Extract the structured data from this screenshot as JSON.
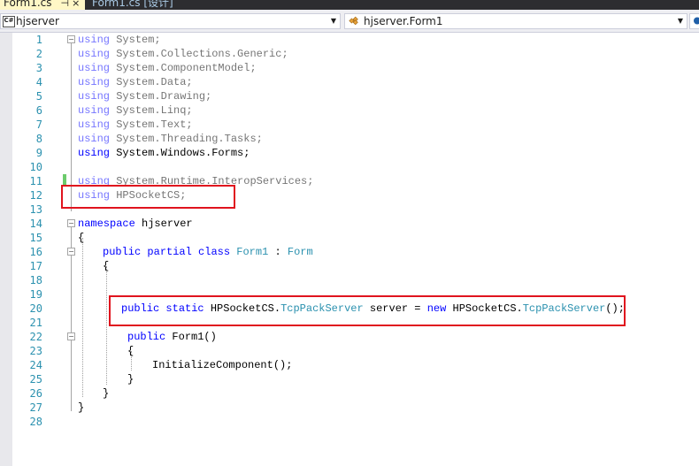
{
  "tabs": [
    {
      "label": "Form1.cs",
      "pin_glyph": "⊣",
      "close_glyph": "×",
      "active": true
    },
    {
      "label": "Form1.cs [设计]",
      "active": false
    }
  ],
  "navbar": {
    "project_badge": "C#",
    "project": "hjserver",
    "class_name": "hjserver.Form1",
    "dropdown_glyph": "▼"
  },
  "code_lines": [
    {
      "n": "1",
      "parts": [
        {
          "t": "using",
          "c": "kw"
        },
        {
          "t": " System;",
          "c": "pl"
        }
      ],
      "dim": true
    },
    {
      "n": "2",
      "parts": [
        {
          "t": "using",
          "c": "kw"
        },
        {
          "t": " System.Collections.Generic;",
          "c": "pl"
        }
      ],
      "dim": true
    },
    {
      "n": "3",
      "parts": [
        {
          "t": "using",
          "c": "kw"
        },
        {
          "t": " System.ComponentModel;",
          "c": "pl"
        }
      ],
      "dim": true
    },
    {
      "n": "4",
      "parts": [
        {
          "t": "using",
          "c": "kw"
        },
        {
          "t": " System.Data;",
          "c": "pl"
        }
      ],
      "dim": true
    },
    {
      "n": "5",
      "parts": [
        {
          "t": "using",
          "c": "kw"
        },
        {
          "t": " System.Drawing;",
          "c": "pl"
        }
      ],
      "dim": true
    },
    {
      "n": "6",
      "parts": [
        {
          "t": "using",
          "c": "kw"
        },
        {
          "t": " System.Linq;",
          "c": "pl"
        }
      ],
      "dim": true
    },
    {
      "n": "7",
      "parts": [
        {
          "t": "using",
          "c": "kw"
        },
        {
          "t": " System.Text;",
          "c": "pl"
        }
      ],
      "dim": true
    },
    {
      "n": "8",
      "parts": [
        {
          "t": "using",
          "c": "kw"
        },
        {
          "t": " System.Threading.Tasks;",
          "c": "pl"
        }
      ],
      "dim": true
    },
    {
      "n": "9",
      "parts": [
        {
          "t": "using",
          "c": "kw"
        },
        {
          "t": " System.Windows.Forms;",
          "c": "pl"
        }
      ],
      "dim": false
    },
    {
      "n": "10",
      "parts": [],
      "dim": false
    },
    {
      "n": "11",
      "parts": [
        {
          "t": "using",
          "c": "kw"
        },
        {
          "t": " System.Runtime.InteropServices;",
          "c": "pl"
        }
      ],
      "dim": true
    },
    {
      "n": "12",
      "parts": [
        {
          "t": "using",
          "c": "kw"
        },
        {
          "t": " HPSocketCS;",
          "c": "pl"
        }
      ],
      "dim": true
    },
    {
      "n": "13",
      "parts": [],
      "dim": false
    },
    {
      "n": "14",
      "parts": [
        {
          "t": "namespace",
          "c": "kw"
        },
        {
          "t": " hjserver",
          "c": "pl"
        }
      ],
      "dim": false
    },
    {
      "n": "15",
      "parts": [
        {
          "t": "{",
          "c": "pl"
        }
      ],
      "dim": false
    },
    {
      "n": "16",
      "parts": [
        {
          "t": "public",
          "c": "kw"
        },
        {
          "t": " ",
          "c": "pl"
        },
        {
          "t": "partial",
          "c": "kw"
        },
        {
          "t": " ",
          "c": "pl"
        },
        {
          "t": "class",
          "c": "kw"
        },
        {
          "t": " ",
          "c": "pl"
        },
        {
          "t": "Form1",
          "c": "ty"
        },
        {
          "t": " : ",
          "c": "pl"
        },
        {
          "t": "Form",
          "c": "ty"
        }
      ],
      "dim": false
    },
    {
      "n": "17",
      "parts": [
        {
          "t": "{",
          "c": "pl"
        }
      ],
      "dim": false
    },
    {
      "n": "18",
      "parts": [],
      "dim": false
    },
    {
      "n": "19",
      "parts": [],
      "dim": false
    },
    {
      "n": "20",
      "parts": [
        {
          "t": "public",
          "c": "kw"
        },
        {
          "t": " ",
          "c": "pl"
        },
        {
          "t": "static",
          "c": "kw"
        },
        {
          "t": " HPSocketCS.",
          "c": "pl"
        },
        {
          "t": "TcpPackServer",
          "c": "ty"
        },
        {
          "t": " server = ",
          "c": "pl"
        },
        {
          "t": "new",
          "c": "kw"
        },
        {
          "t": " HPSocketCS.",
          "c": "pl"
        },
        {
          "t": "TcpPackServer",
          "c": "ty"
        },
        {
          "t": "();",
          "c": "pl"
        }
      ],
      "dim": false
    },
    {
      "n": "21",
      "parts": [],
      "dim": false
    },
    {
      "n": "22",
      "parts": [
        {
          "t": "public",
          "c": "kw"
        },
        {
          "t": " Form1()",
          "c": "pl"
        }
      ],
      "dim": false
    },
    {
      "n": "23",
      "parts": [
        {
          "t": "{",
          "c": "pl"
        }
      ],
      "dim": false
    },
    {
      "n": "24",
      "parts": [
        {
          "t": "InitializeComponent();",
          "c": "pl"
        }
      ],
      "dim": false
    },
    {
      "n": "25",
      "parts": [
        {
          "t": "}",
          "c": "pl"
        }
      ],
      "dim": false
    },
    {
      "n": "26",
      "parts": [
        {
          "t": "}",
          "c": "pl"
        }
      ],
      "dim": false
    },
    {
      "n": "27",
      "parts": [
        {
          "t": "}",
          "c": "pl"
        }
      ],
      "dim": false
    },
    {
      "n": "28",
      "parts": [],
      "dim": false
    }
  ],
  "colors": {
    "keyword": "#0000ff",
    "type": "#2b91af",
    "line_number": "#2b91af",
    "highlight_box": "#e0141e",
    "change_marker": "#6ccb6c",
    "active_tab": "#fff7c6"
  }
}
